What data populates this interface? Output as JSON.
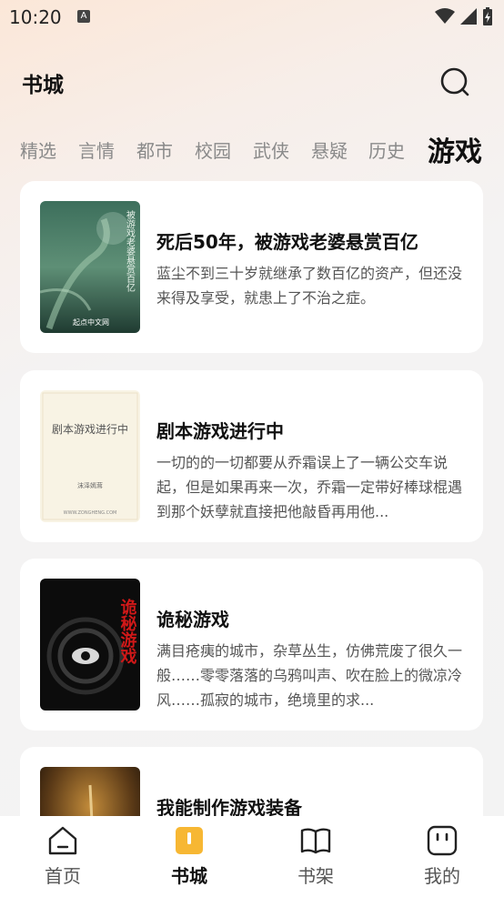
{
  "status_bar": {
    "time": "10:20",
    "notification_letter": "A"
  },
  "header": {
    "title": "书城"
  },
  "tabs": [
    {
      "label": "精选",
      "active": false
    },
    {
      "label": "言情",
      "active": false
    },
    {
      "label": "都市",
      "active": false
    },
    {
      "label": "校园",
      "active": false
    },
    {
      "label": "武侠",
      "active": false
    },
    {
      "label": "悬疑",
      "active": false
    },
    {
      "label": "历史",
      "active": false
    },
    {
      "label": "游戏",
      "active": true
    }
  ],
  "books": [
    {
      "title": "死后50年，被游戏老婆悬赏百亿",
      "description": "蓝尘不到三十岁就继承了数百亿的资产，但还没来得及享受，就患上了不治之症。",
      "cover": {
        "text": "被游戏老婆悬赏百亿",
        "publisher": "起点中文网"
      }
    },
    {
      "title": "剧本游戏进行中",
      "description": "一切的的一切都要从乔霜误上了一辆公交车说起，但是如果再来一次，乔霜一定带好棒球棍遇到那个妖孽就直接把他敲昏再用他...",
      "cover": {
        "text": "剧本游戏进行中",
        "author": "沫泽嫣茸",
        "site": "WWW.ZONGHENG.COM"
      }
    },
    {
      "title": "诡秘游戏",
      "description": "满目疮痍的城市，杂草丛生，仿佛荒废了很久一般……零零落落的乌鸦叫声、吹在脸上的微凉冷风……孤寂的城市，绝境里的求...",
      "cover": {
        "text": "诡秘游戏"
      }
    },
    {
      "title": "我能制作游戏装备",
      "description": "",
      "cover": {
        "text": ""
      }
    }
  ],
  "bottom_nav": [
    {
      "label": "首页",
      "icon": "home-icon",
      "active": false
    },
    {
      "label": "书城",
      "icon": "bookstore-icon",
      "active": true
    },
    {
      "label": "书架",
      "icon": "bookshelf-icon",
      "active": false
    },
    {
      "label": "我的",
      "icon": "profile-icon",
      "active": false
    }
  ],
  "colors": {
    "accent": "#f7b733",
    "active_text": "#111111",
    "inactive_text": "#8a8a8a"
  }
}
